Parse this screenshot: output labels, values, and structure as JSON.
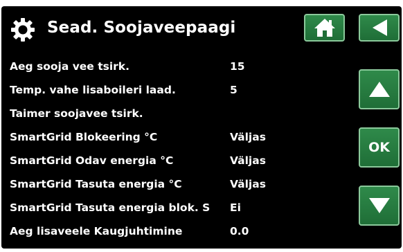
{
  "header": {
    "title": "Sead. Soojaveepaagi",
    "icon": "gear-icon"
  },
  "buttons": {
    "home_icon": "home-icon",
    "back_icon": "back-arrow-icon",
    "up_icon": "up-arrow-icon",
    "ok_label": "OK",
    "down_icon": "down-arrow-icon"
  },
  "colors": {
    "background": "#000000",
    "button": "#2a8043",
    "button_border": "#8bc99b",
    "text": "#ffffff"
  },
  "settings": [
    {
      "label": "Aeg sooja vee tsirk.",
      "value": "15"
    },
    {
      "label": "Temp. vahe lisaboileri laad.",
      "value": "5"
    },
    {
      "label": "Taimer soojavee tsirk.",
      "value": ""
    },
    {
      "label": "SmartGrid Blokeering °C",
      "value": "Väljas"
    },
    {
      "label": "SmartGrid Odav energia °C",
      "value": "Väljas"
    },
    {
      "label": "SmartGrid Tasuta energia °C",
      "value": "Väljas"
    },
    {
      "label": "SmartGrid Tasuta energia blok. S",
      "value": "Ei"
    },
    {
      "label": "Aeg lisaveele Kaugjuhtimine",
      "value": "0.0"
    }
  ]
}
